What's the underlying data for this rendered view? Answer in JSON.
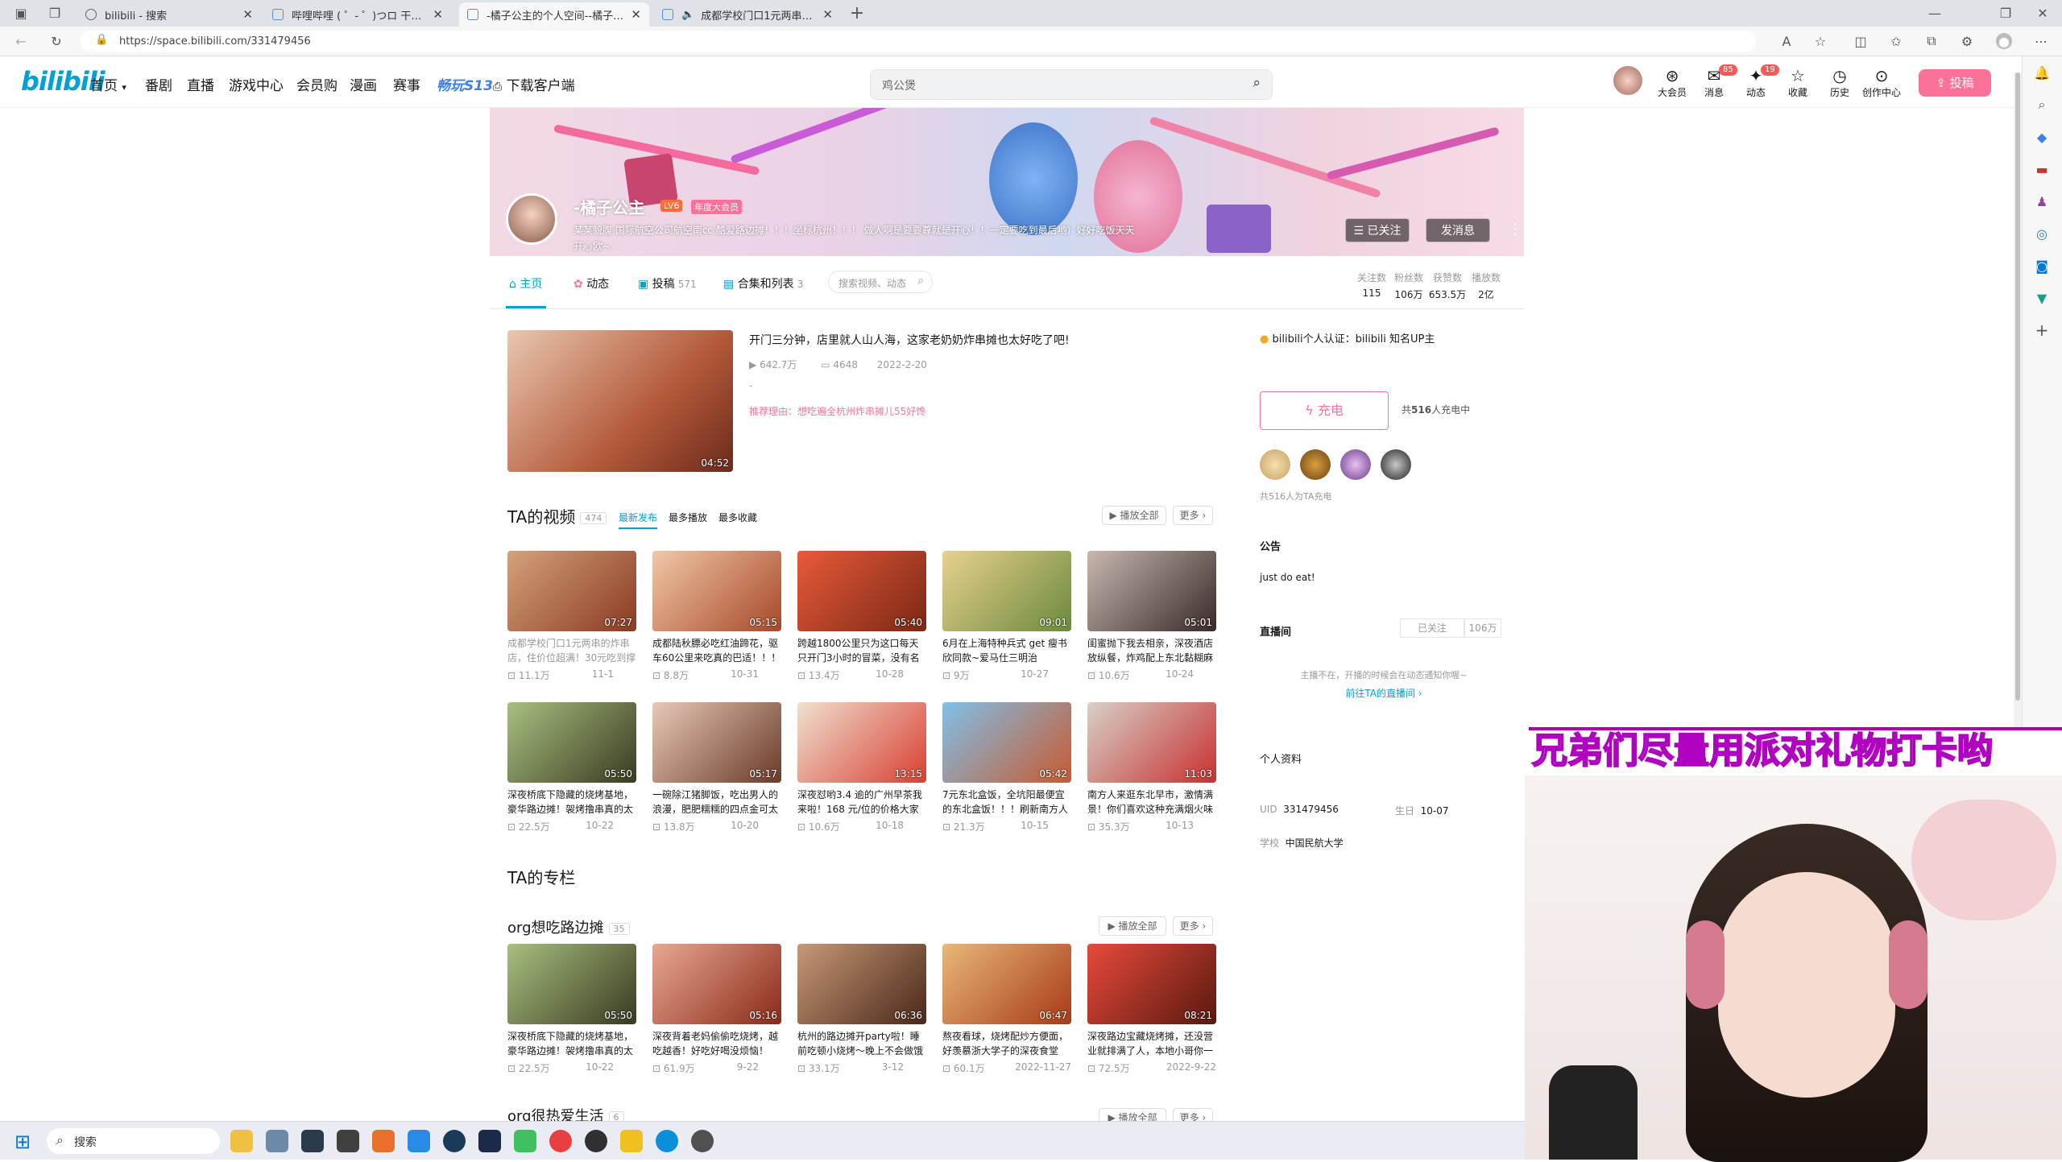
{
  "browser": {
    "tabs": [
      {
        "label": "bilibili - 搜索"
      },
      {
        "label": "哔哩哔哩 ( ゜- ゜)つロ 干杯~-bili"
      },
      {
        "label": "-橘子公主的个人空间--橘子公主"
      },
      {
        "label": "成都学校门口1元两串的炸串"
      }
    ],
    "url": "https://space.bilibili.com/331479456"
  },
  "header": {
    "logo": "bilibili",
    "nav": [
      "首页",
      "番剧",
      "直播",
      "游戏中心",
      "会员购",
      "漫画",
      "赛事",
      "畅玩S13",
      "下载客户端"
    ],
    "search_placeholder": "鸡公煲",
    "icons": [
      {
        "label": "大会员",
        "icon": "vip-icon"
      },
      {
        "label": "消息",
        "badge": "85",
        "icon": "message-icon"
      },
      {
        "label": "动态",
        "badge": "19",
        "icon": "dynamic-icon"
      },
      {
        "label": "收藏",
        "icon": "star-icon"
      },
      {
        "label": "历史",
        "icon": "clock-icon"
      },
      {
        "label": "创作中心",
        "icon": "bulb-icon"
      }
    ],
    "upload": "投稿"
  },
  "profile": {
    "name": "-橘子公主",
    "level": "LV6",
    "vip": "年度大会员",
    "sign": "某某貌腹 国际航空公司航空南cc 酷爱路边摊！！！坐标杭州！！！ 做人啊是要要尊就是开心！！一定要吃到最后哟）好好吃饭天天开心欧~",
    "followed": "已关注",
    "message": "发消息"
  },
  "tabs": {
    "items": [
      {
        "label": "主页"
      },
      {
        "label": "动态"
      },
      {
        "label": "投稿",
        "count": "571"
      },
      {
        "label": "合集和列表",
        "count": "3"
      }
    ],
    "search_placeholder": "搜索视频、动态",
    "stats": [
      {
        "label": "关注数",
        "value": "115"
      },
      {
        "label": "粉丝数",
        "value": "106万"
      },
      {
        "label": "获赞数",
        "value": "653.5万"
      },
      {
        "label": "播放数",
        "value": "2亿"
      }
    ]
  },
  "featured": {
    "title": "开门三分钟，店里就人山人海，这家老奶奶炸串摊也太好吃了吧!",
    "views": "642.7万",
    "comments": "4648",
    "date": "2022-2-20",
    "dash": "-",
    "reason": "推荐理由：想吃遍全杭州炸串摊儿55好馋",
    "duration": "04:52"
  },
  "videos": {
    "section": "TA的视频",
    "count": "474",
    "sorts": [
      "最新发布",
      "最多播放",
      "最多收藏"
    ],
    "play_all": "播放全部",
    "more": "更多",
    "items": [
      {
        "title": "成都学校门口1元两串的炸串店，住价位超满！30元吃到撑",
        "views": "11.1万",
        "date": "11-1",
        "dur": "07:27"
      },
      {
        "title": "成都陆秋膘必吃红油蹄花，驱车60公里来吃真的巴适！！！",
        "views": "8.8万",
        "date": "10-31",
        "dur": "05:15"
      },
      {
        "title": "跨越1800公里只为这口每天只开门3小时的冒菜，没有名字！",
        "views": "13.4万",
        "date": "10-28",
        "dur": "05:40"
      },
      {
        "title": "6月在上海特种兵式 get 瘦书欣同款~爱马仕三明治",
        "views": "9万",
        "date": "10-27",
        "dur": "09:01"
      },
      {
        "title": "闺蜜抛下我去相亲，深夜酒店放纵餐，炸鸡配上东北黏糊麻",
        "views": "10.6万",
        "date": "10-24",
        "dur": "05:01"
      },
      {
        "title": "深夜桥底下隐藏的烧烤基地，豪华路边摊！袈烤撸串真的太爽",
        "views": "22.5万",
        "date": "10-22",
        "dur": "05:50"
      },
      {
        "title": "一碗除江猪脚饭，吃出男人的浪漫，肥肥糯糯的四点金可太香",
        "views": "13.8万",
        "date": "10-20",
        "dur": "05:17"
      },
      {
        "title": "深夜怼哟3.4 逾的广州早茶我来啦！168 元/位的价格大家",
        "views": "10.6万",
        "date": "10-18",
        "dur": "13:15"
      },
      {
        "title": "7元东北盒饭，全坑阳最便宜的东北盒饭！！！刷新南方人",
        "views": "21.3万",
        "date": "10-15",
        "dur": "05:42"
      },
      {
        "title": "南方人来逛东北早市，激情满景！你们喜欢这种充满烟火味",
        "views": "35.3万",
        "date": "10-13",
        "dur": "11:03"
      }
    ]
  },
  "column": {
    "section": "TA的专栏"
  },
  "collection": {
    "section": "org想吃路边摊",
    "count": "35",
    "play_all": "播放全部",
    "more": "更多",
    "items": [
      {
        "title": "深夜桥底下隐藏的烧烤基地，豪华路边摊！袈烤撸串真的太爽",
        "views": "22.5万",
        "date": "10-22",
        "dur": "05:50"
      },
      {
        "title": "深夜背着老妈偷偷吃烧烤，越吃越香！好吃好喝没烦恼！",
        "views": "61.9万",
        "date": "9-22",
        "dur": "05:16"
      },
      {
        "title": "杭州的路边摊开party啦！睡前吃顿小烧烤～晚上不会做饿梦",
        "views": "33.1万",
        "date": "3-12",
        "dur": "06:36"
      },
      {
        "title": "熬夜看球，烧烤配炒方便面，好羡慕浙大学子的深夜食堂",
        "views": "60.1万",
        "date": "2022-11-27",
        "dur": "06:47"
      },
      {
        "title": "深夜路边宝藏烧烤摊，还没营业就排满了人，本地小哥你一定",
        "views": "72.5万",
        "date": "2022-9-22",
        "dur": "08:21"
      }
    ]
  },
  "collection2": {
    "section": "org很热爱生活",
    "count": "6",
    "play_all": "播放全部",
    "more": "更多"
  },
  "sidebar": {
    "verify": "bilibili个人认证：bilibili 知名UP主",
    "charge_btn": "充电",
    "charge_count_prefix": "共",
    "charge_count": "516",
    "charge_count_suffix": "人充电中",
    "charge_total": "共516人为TA充电",
    "notice_title": "公告",
    "notice": "just do eat!",
    "live_title": "直播间",
    "live_followed": "已关注",
    "live_fans": "106万",
    "live_off": "主播不在，开播的时候会在动态通知你喔~",
    "live_link": "前往TA的直播间",
    "info_title": "个人资料",
    "uid_label": "UID",
    "uid": "331479456",
    "birth_label": "生日",
    "birth": "10-07",
    "school_label": "学校",
    "school": "中国民航大学"
  },
  "overlay": {
    "text": "兄弟们尽量用派对礼物打卡哟"
  },
  "taskbar": {
    "search": "搜索"
  }
}
